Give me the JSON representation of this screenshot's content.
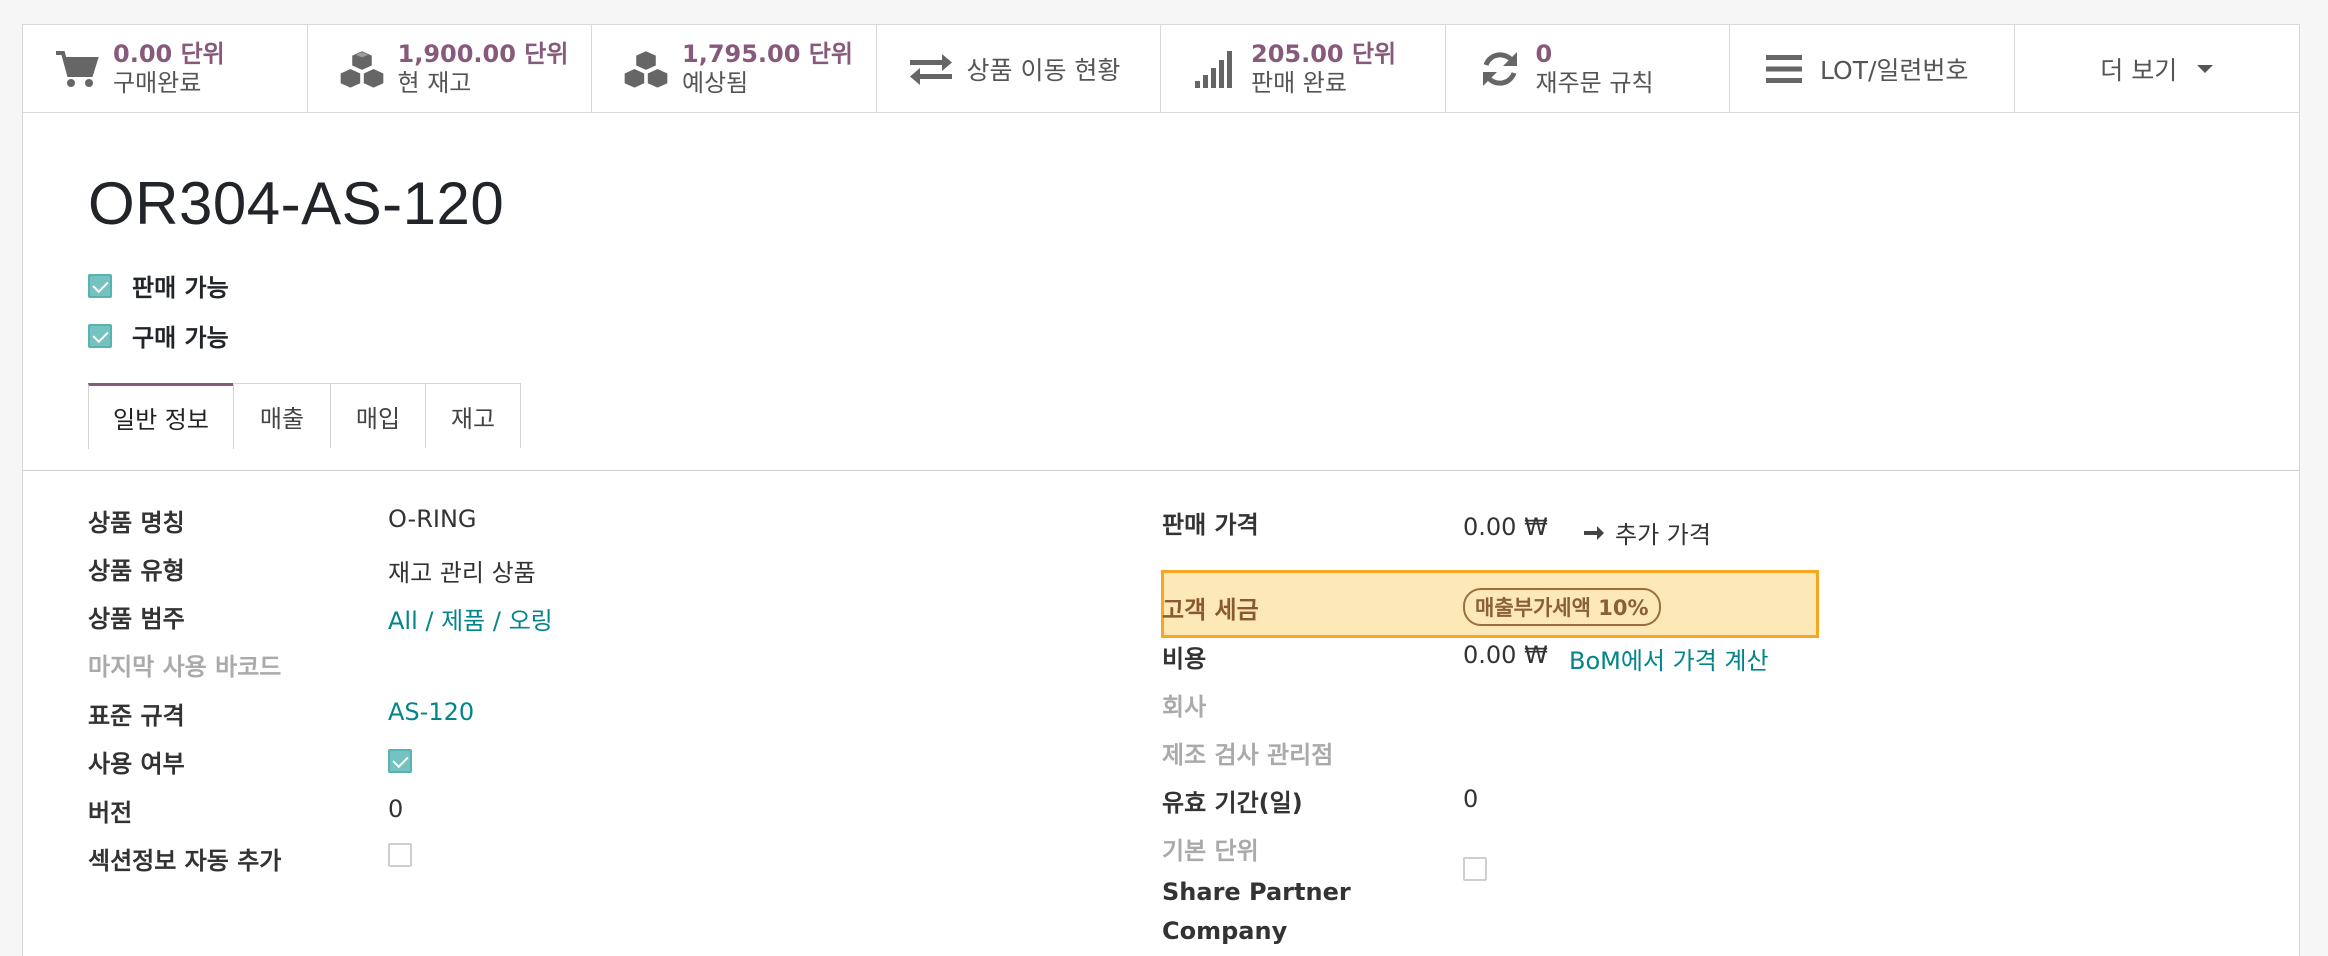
{
  "smart_buttons": [
    {
      "icon": "cart-icon",
      "value": "0.00 단위",
      "label": "구매완료"
    },
    {
      "icon": "cubes-icon",
      "value": "1,900.00 단위",
      "label": "현 재고"
    },
    {
      "icon": "cubes-icon",
      "value": "1,795.00 단위",
      "label": "예상됨"
    },
    {
      "icon": "exchange-icon",
      "label": "상품 이동 현황"
    },
    {
      "icon": "signal-icon",
      "value": "205.00 단위",
      "label": "판매 완료"
    },
    {
      "icon": "refresh-icon",
      "value": "0",
      "label": "재주문 규칙"
    },
    {
      "icon": "bars-icon",
      "label": "LOT/일련번호"
    },
    {
      "label": "더 보기"
    }
  ],
  "product": {
    "name": "OR304-AS-120",
    "can_be_sold": {
      "label": "판매 가능",
      "checked": true
    },
    "can_be_purchased": {
      "label": "구매 가능",
      "checked": true
    }
  },
  "tabs": [
    "일반 정보",
    "매출",
    "매입",
    "재고"
  ],
  "left_fields": {
    "product_name": {
      "label": "상품 명칭",
      "value": "O-RING"
    },
    "product_type": {
      "label": "상품 유형",
      "value": "재고 관리 상품"
    },
    "category": {
      "label": "상품 범주",
      "value": "All / 제품 / 오링"
    },
    "barcode": {
      "label": "마지막 사용 바코드"
    },
    "standard": {
      "label": "표준 규격",
      "value": "AS-120"
    },
    "active": {
      "label": "사용 여부",
      "checked": true
    },
    "version": {
      "label": "버전",
      "value": "0"
    },
    "section_auto": {
      "label": "섹션정보 자동 추가",
      "checked": false
    }
  },
  "right_fields": {
    "sales_price": {
      "label": "판매 가격",
      "value": "0.00 ₩",
      "extra": "추가 가격"
    },
    "customer_tax": {
      "label": "고객 세금",
      "tag": "매출부가세액 10%"
    },
    "cost": {
      "label": "비용",
      "value": "0.00 ₩",
      "action": "BoM에서 가격 계산"
    },
    "company": {
      "label": "회사"
    },
    "inspection": {
      "label": "제조 검사 관리점"
    },
    "validity": {
      "label": "유효 기간(일)",
      "value": "0"
    },
    "uom": {
      "label": "기본 단위"
    },
    "share_partner": {
      "label_line1": "Share Partner",
      "label_line2": "Company",
      "checked": false
    }
  },
  "colors": {
    "accent": "#875a7b",
    "link": "#01858a",
    "highlight": "#f5a623"
  }
}
